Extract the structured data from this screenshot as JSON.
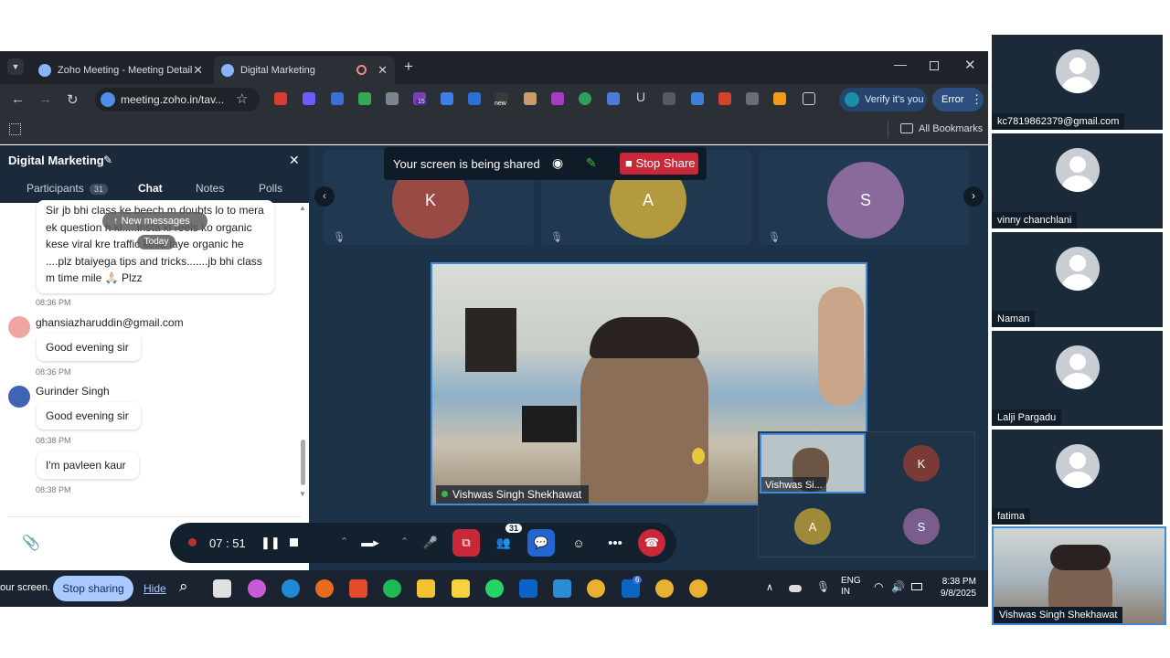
{
  "browser": {
    "tabs": [
      {
        "label": "Zoho Meeting - Meeting Detail"
      },
      {
        "label": "Digital Marketing"
      }
    ],
    "url": "meeting.zoho.in/tav...",
    "verify_label": "Verify it's you",
    "error_label": "Error",
    "all_bookmarks": "All Bookmarks",
    "ext_badges": {
      "b15": "15",
      "new": "new"
    }
  },
  "leftpanel": {
    "title": "Digital Marketing",
    "tabs": {
      "participants": "Participants",
      "participants_count": "31",
      "chat": "Chat",
      "notes": "Notes",
      "polls": "Polls"
    },
    "new_messages": "New messages",
    "today": "Today",
    "messages": [
      {
        "text": "Sir jb bhi class ke beech m doubts lo to mera ek question h ki.....insta ki reels ko organic kese viral kre traffic kese laye organic he ....plz btaiyega tips and tricks.......jb bhi class m time mile 🙏🏻 Plzz",
        "time": "08:36 PM"
      },
      {
        "sender": "ghansiazharuddin@gmail.com",
        "text": "Good evening sir",
        "time": "08:36 PM"
      },
      {
        "sender": "Gurinder Singh",
        "text": "Good evening sir",
        "time": "08:38 PM"
      },
      {
        "text": "I'm pavleen kaur",
        "time": "08:38 PM"
      }
    ]
  },
  "meeting": {
    "share_banner": "Your screen is being shared",
    "stop_share": "Stop Share",
    "top_participants": [
      {
        "initial": "K",
        "color": "#9a4a45"
      },
      {
        "initial": "A",
        "color": "#b39a3e"
      },
      {
        "initial": "S",
        "color": "#8a6a9c"
      }
    ],
    "speaker_name": "Vishwas Singh Shekhawat",
    "mini_self_name": "Vishwas Si...",
    "grid_participants": [
      {
        "initial": "K",
        "color": "#7a3a36"
      },
      {
        "initial": "A",
        "color": "#9f8a3a"
      },
      {
        "initial": "S",
        "color": "#7a5d8c"
      }
    ]
  },
  "controls": {
    "timer": "07 : 51",
    "participants_badge": "31"
  },
  "taskbar": {
    "share_text": "our screen.",
    "stop_sharing": "Stop sharing",
    "hide": "Hide",
    "lang1": "ENG",
    "lang2": "IN",
    "time": "8:38 PM",
    "date": "9/8/2025",
    "linkedin_badge": "6"
  },
  "rightcol": {
    "participants": [
      {
        "name": "kc7819862379@gmail.com"
      },
      {
        "name": "vinny chanchlani"
      },
      {
        "name": "Naman"
      },
      {
        "name": "Lalji Pargadu"
      },
      {
        "name": "fatima"
      },
      {
        "name": "Vishwas Singh Shekhawat"
      }
    ]
  }
}
